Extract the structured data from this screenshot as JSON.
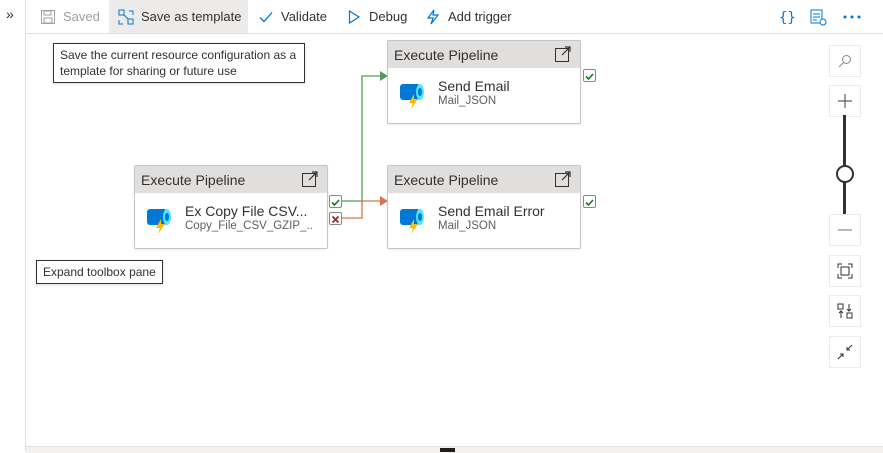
{
  "toolbar": {
    "saved_label": "Saved",
    "save_template_label": "Save as template",
    "validate_label": "Validate",
    "debug_label": "Debug",
    "add_trigger_label": "Add trigger"
  },
  "tooltips": {
    "save_template": "Save the current resource configuration as a template for sharing or future use",
    "expand_toolbox": "Expand toolbox pane"
  },
  "nodes": [
    {
      "header": "Execute Pipeline",
      "title": "Send Email",
      "subtitle": "Mail_JSON"
    },
    {
      "header": "Execute Pipeline",
      "title": "Ex Copy File CSV...",
      "subtitle": "Copy_File_CSV_GZIP_..."
    },
    {
      "header": "Execute Pipeline",
      "title": "Send Email Error",
      "subtitle": "Mail_JSON"
    }
  ],
  "colors": {
    "success": "#107c10",
    "failure": "#a4262c",
    "success_link": "#5b9a5b",
    "failure_link": "#d9734e",
    "accent": "#0078d4"
  },
  "icons": [
    "expand-chevrons-icon",
    "save-icon",
    "template-icon",
    "check-icon",
    "play-icon",
    "trigger-icon",
    "code-icon",
    "properties-icon",
    "more-icon",
    "open-external-icon",
    "pipeline-icon",
    "search-icon",
    "zoom-in-icon",
    "zoom-out-icon",
    "fit-screen-icon",
    "auto-align-icon",
    "collapse-icon"
  ]
}
